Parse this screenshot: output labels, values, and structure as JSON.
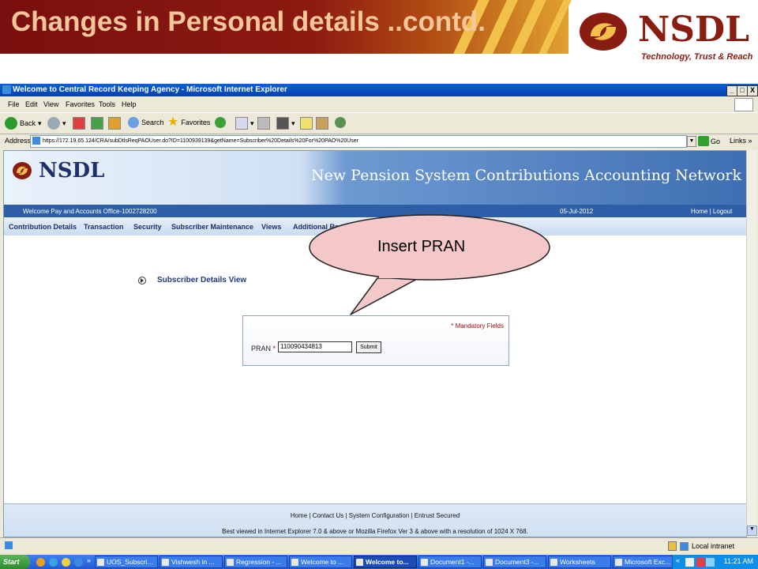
{
  "slide": {
    "title": "Changes in Personal details ..contd.",
    "logo_text": "NSDL",
    "tagline": "Technology, Trust & Reach",
    "callout": "Insert PRAN"
  },
  "window": {
    "title": "Welcome to Central Record Keeping Agency - Microsoft Internet Explorer",
    "min": "_",
    "max": "□",
    "close": "X"
  },
  "menu": [
    "File",
    "Edit",
    "View",
    "Favorites",
    "Tools",
    "Help"
  ],
  "toolbar": {
    "back": "Back",
    "search": "Search",
    "favorites": "Favorites"
  },
  "address": {
    "label": "Address",
    "url": "https://172.19.65.124/CRA/subDtlsReqPAOUser.do?ID=1100939139&getName=Subscriber%20Details%20For%20PAO%20User",
    "go": "Go",
    "links": "Links »"
  },
  "site": {
    "logo": "NSDL",
    "banner": "New Pension System Contributions Accounting Network",
    "welcome": "Welcome Pay and Accounts Office-1002728200",
    "date": "05-Jul-2012",
    "home_logout": "Home | Logout",
    "nav": [
      "Contribution Details",
      "Transaction",
      "Security",
      "Subscriber Maintenance",
      "Views",
      "Additional Reports (New)"
    ]
  },
  "form": {
    "section_title": "Subscriber Details View",
    "mandatory": "* Mandatory Fields",
    "pran_label": "PRAN",
    "pran_star": "*",
    "pran_value": "110090434813",
    "submit": "Submit"
  },
  "footer": {
    "links": "Home   |   Contact Us   |   System Configuration   |   Entrust Secured",
    "note": "Best viewed in Internet Explorer 7.0 & above or Mozilla Firefox Ver 3 & above with a resolution of 1024 X 768."
  },
  "status": {
    "zone": "Local intranet"
  },
  "taskbar": {
    "start": "Start",
    "chevron": "»",
    "tasks": [
      "UOS_Subscri...",
      "Vishwesh in ...",
      "Regression - ...",
      "Welcome to ...",
      "Welcome to...",
      "Document1 -...",
      "Document3 -...",
      "Worksheets",
      "Microsoft Exc..."
    ],
    "tray_chevron": "«",
    "clock": "11:21 AM"
  }
}
